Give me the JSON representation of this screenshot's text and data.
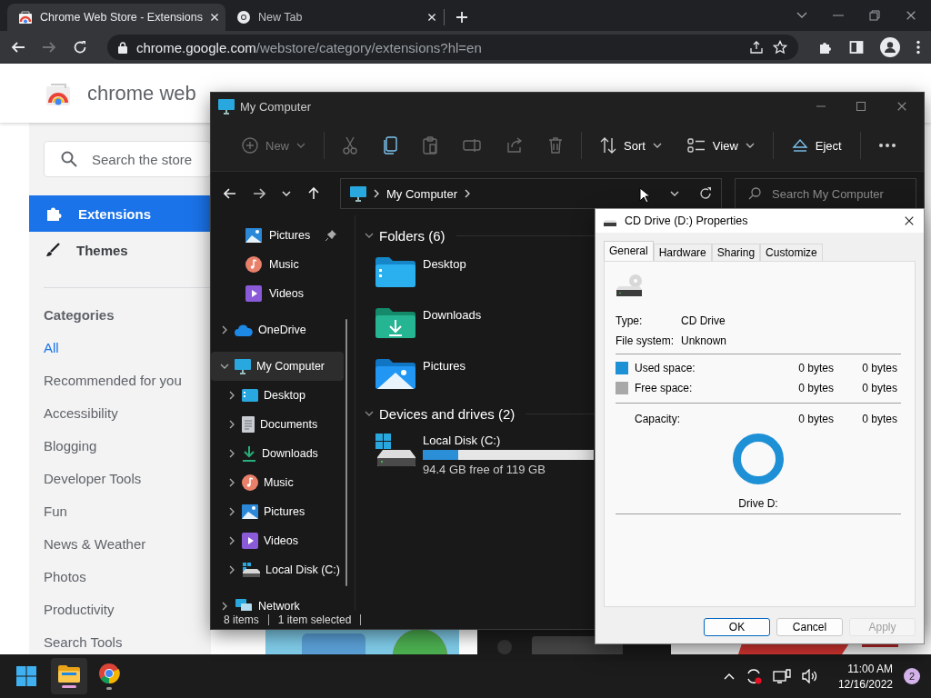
{
  "browser": {
    "tabs": [
      {
        "kind": "webstore",
        "title": "Chrome Web Store - Extensions",
        "selected": true
      },
      {
        "kind": "newtab",
        "title": "New Tab",
        "selected": false
      }
    ],
    "can_go_forward": false,
    "url": {
      "host": "chrome.google.com",
      "path": "/webstore/category/extensions?hl=en"
    }
  },
  "store": {
    "title": "chrome web",
    "search": {
      "placeholder": "Search the store"
    },
    "nav": [
      {
        "kind": "extensions",
        "label": "Extensions",
        "selected": true
      },
      {
        "kind": "themes",
        "label": "Themes",
        "selected": false
      }
    ],
    "categories_heading": "Categories",
    "categories": [
      {
        "label": "All",
        "selected": true
      },
      {
        "label": "Recommended for you",
        "selected": false
      },
      {
        "label": "Accessibility",
        "selected": false
      },
      {
        "label": "Blogging",
        "selected": false
      },
      {
        "label": "Developer Tools",
        "selected": false
      },
      {
        "label": "Fun",
        "selected": false
      },
      {
        "label": "News & Weather",
        "selected": false
      },
      {
        "label": "Photos",
        "selected": false
      },
      {
        "label": "Productivity",
        "selected": false
      },
      {
        "label": "Search Tools",
        "selected": false
      }
    ]
  },
  "explorer": {
    "title": "My Computer",
    "toolbar": [
      {
        "kind": "new",
        "label": "New",
        "disabled": true
      },
      {
        "kind": "cut",
        "disabled": true
      },
      {
        "kind": "copy",
        "disabled": false
      },
      {
        "kind": "paste",
        "disabled": true
      },
      {
        "kind": "rename",
        "disabled": true
      },
      {
        "kind": "share",
        "disabled": true
      },
      {
        "kind": "delete",
        "disabled": true
      },
      {
        "kind": "sort",
        "label": "Sort",
        "disabled": false
      },
      {
        "kind": "view",
        "label": "View",
        "disabled": false
      },
      {
        "kind": "eject",
        "label": "Eject",
        "disabled": false
      },
      {
        "kind": "more",
        "disabled": false
      }
    ],
    "address": [
      "My Computer"
    ],
    "search": {
      "placeholder": "Search My Computer"
    },
    "quick_access": [
      {
        "label": "Pictures",
        "kind": "pictures",
        "pinned": true
      },
      {
        "label": "Music",
        "kind": "music",
        "pinned": false
      },
      {
        "label": "Videos",
        "kind": "videos",
        "pinned": false
      }
    ],
    "tree": [
      {
        "label": "OneDrive",
        "kind": "cloud",
        "expanded": false,
        "selected": false
      },
      {
        "label": "My Computer",
        "kind": "computer",
        "expanded": true,
        "selected": true,
        "children": [
          {
            "label": "Desktop",
            "kind": "desktop",
            "expanded": false,
            "selected": false
          },
          {
            "label": "Documents",
            "kind": "documents",
            "expanded": false,
            "selected": false
          },
          {
            "label": "Downloads",
            "kind": "downloads",
            "expanded": false,
            "selected": false
          },
          {
            "label": "Music",
            "kind": "music",
            "expanded": false,
            "selected": false
          },
          {
            "label": "Pictures",
            "kind": "pictures",
            "expanded": false,
            "selected": false
          },
          {
            "label": "Videos",
            "kind": "videos",
            "expanded": false,
            "selected": false
          },
          {
            "label": "Local Disk (C:)",
            "kind": "drive",
            "expanded": false,
            "selected": false
          }
        ]
      },
      {
        "label": "Network",
        "kind": "network",
        "expanded": false,
        "selected": false
      }
    ],
    "groups": [
      {
        "title": "Folders (6)",
        "expanded": true,
        "items": [
          {
            "kind": "desktop",
            "name": "Desktop"
          },
          {
            "kind": "downloads",
            "name": "Downloads"
          },
          {
            "kind": "pictures",
            "name": "Pictures"
          }
        ]
      },
      {
        "title": "Devices and drives (2)",
        "expanded": true,
        "items": [
          {
            "kind": "drive",
            "name": "Local Disk (C:)",
            "level": 0.21,
            "detail": "94.4 GB free of 119 GB"
          }
        ]
      }
    ],
    "status": [
      "8 items",
      "1 item selected"
    ]
  },
  "dialog": {
    "title": "CD Drive (D:) Properties",
    "tabs": [
      {
        "label": "General",
        "selected": true
      },
      {
        "label": "Hardware",
        "selected": false
      },
      {
        "label": "Sharing",
        "selected": false
      },
      {
        "label": "Customize",
        "selected": false
      }
    ],
    "fields": [
      {
        "label": "Type:",
        "value": "CD Drive"
      },
      {
        "label": "File system:",
        "value": "Unknown"
      }
    ],
    "space": [
      {
        "label": "Used space:",
        "color": "#1e90d6",
        "bytes": "0 bytes",
        "size": "0 bytes"
      },
      {
        "label": "Free space:",
        "color": "#a8a8a8",
        "bytes": "0 bytes",
        "size": "0 bytes"
      }
    ],
    "capacity": {
      "label": "Capacity:",
      "bytes": "0 bytes",
      "size": "0 bytes"
    },
    "drive_label": "Drive D:",
    "buttons": [
      {
        "label": "OK",
        "default": true,
        "disabled": false
      },
      {
        "label": "Cancel",
        "default": false,
        "disabled": false
      },
      {
        "label": "Apply",
        "default": false,
        "disabled": true
      }
    ]
  },
  "taskbar": {
    "apps": [
      {
        "kind": "explorer",
        "active": true
      },
      {
        "kind": "chrome",
        "active": false
      }
    ],
    "time": "11:00 AM",
    "date": "12/16/2022",
    "notifications": "2"
  }
}
